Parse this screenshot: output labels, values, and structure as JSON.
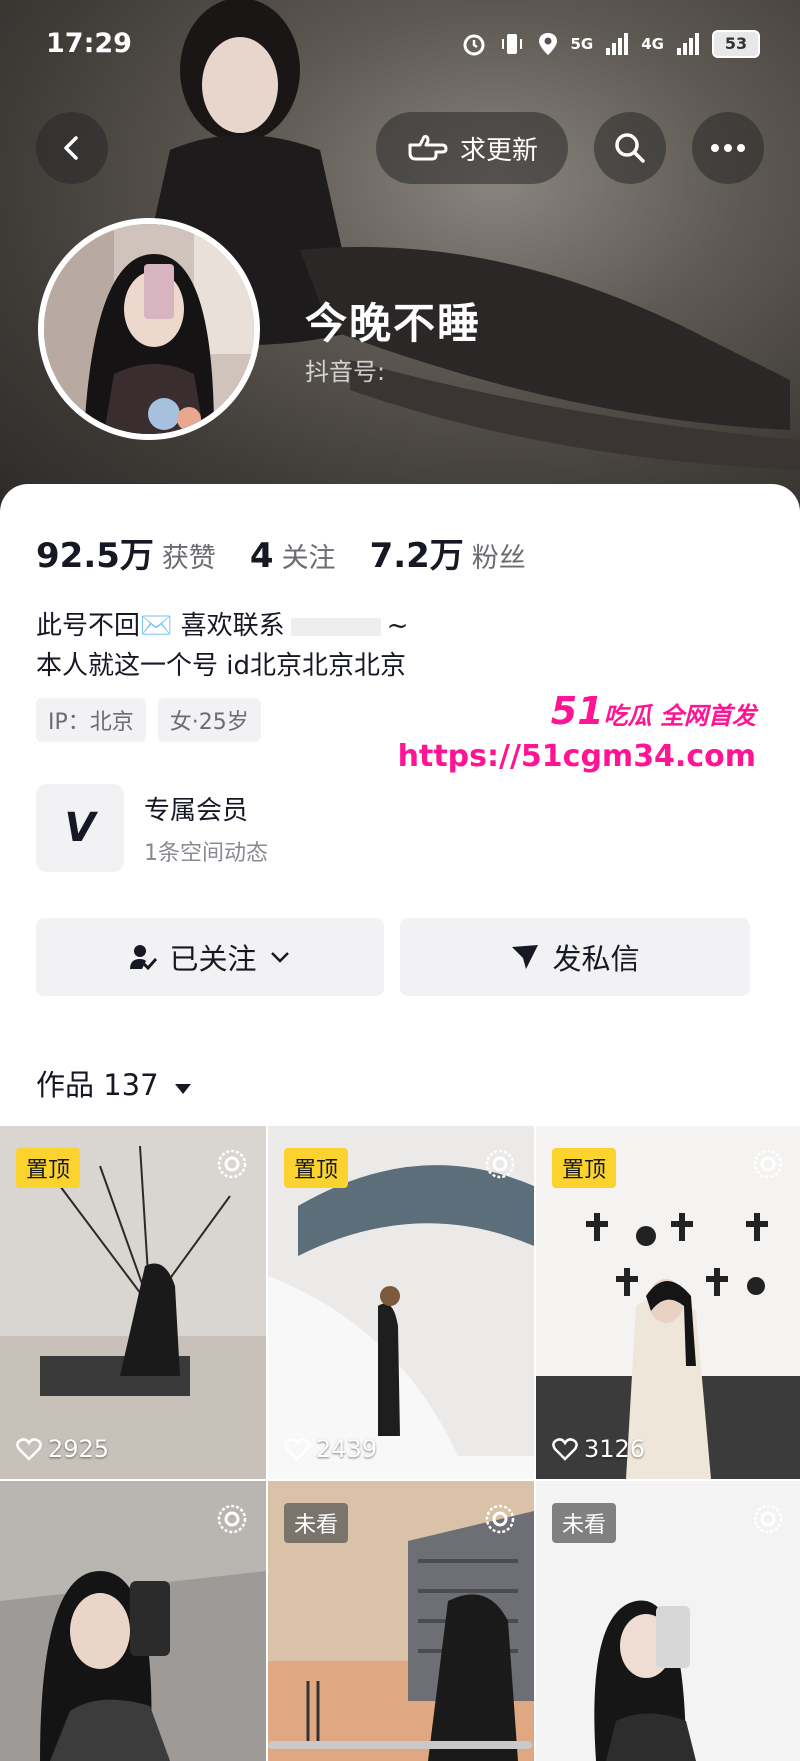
{
  "status_bar": {
    "time": "17:29",
    "network_1": "5G",
    "network_2": "4G",
    "battery": "53"
  },
  "header": {
    "request_update_label": "求更新",
    "username": "今晚不睡",
    "douyin_id_label": "抖音号:"
  },
  "stats": [
    {
      "value": "92.5万",
      "label": "获赞"
    },
    {
      "value": "4",
      "label": "关注"
    },
    {
      "value": "7.2万",
      "label": "粉丝"
    }
  ],
  "bio": {
    "line1": "此号不回✉️ 喜欢联系",
    "line1_tail": "~",
    "line2": "本人就这一个号  id北京北京北京"
  },
  "tags": [
    "IP：北京",
    "女·25岁"
  ],
  "watermark": {
    "brand": "51",
    "brand_suffix": "吃瓜 全网首发",
    "url": "https://51cgm34.com"
  },
  "vip": {
    "icon_letter": "V",
    "title": "专属会员",
    "subtitle": "1条空间动态"
  },
  "actions": {
    "follow_label": "已关注",
    "message_label": "发私信"
  },
  "works": {
    "label": "作品 137"
  },
  "grid": [
    {
      "badge": "置顶",
      "likes": "2925"
    },
    {
      "badge": "置顶",
      "likes": "2439"
    },
    {
      "badge": "置顶",
      "likes": "3126"
    },
    {
      "badge": "",
      "likes": ""
    },
    {
      "badge": "未看",
      "likes": ""
    },
    {
      "badge": "未看",
      "likes": ""
    }
  ],
  "colors": {
    "accent_pink": "#ff1493",
    "pin_yellow": "#fbd22e",
    "button_grey": "#f2f2f4"
  }
}
